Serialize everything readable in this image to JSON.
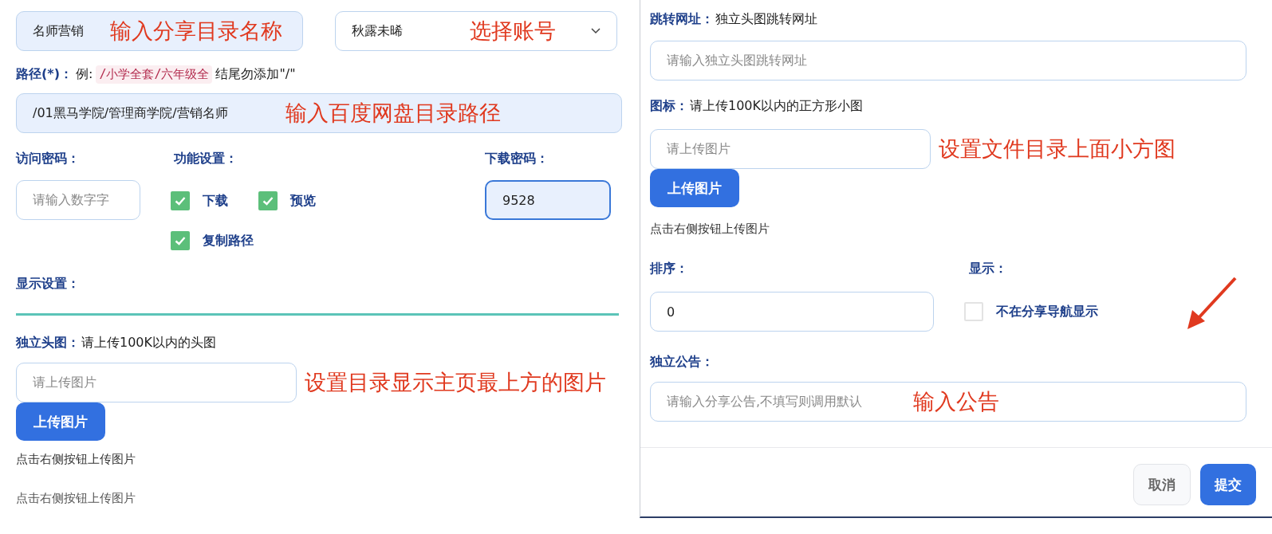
{
  "left_panel": {
    "name_field": {
      "value": "名师营销",
      "annotation": "输入分享目录名称"
    },
    "account_select": {
      "value": "秋露未晞",
      "annotation": "选择账号"
    },
    "path_hint": {
      "label": "路径(*)：",
      "prefix": "例:",
      "example": "/小学全套/六年级全",
      "suffix": "结尾勿添加\"/\""
    },
    "path_field": {
      "value": "/01黑马学院/管理商学院/营销名师",
      "annotation": "输入百度网盘目录路径"
    },
    "access_password": {
      "label": "访问密码：",
      "placeholder": "请输入数字字"
    },
    "features": {
      "label": "功能设置：",
      "options": [
        {
          "label": "下载",
          "checked": true
        },
        {
          "label": "预览",
          "checked": true
        },
        {
          "label": "复制路径",
          "checked": true
        }
      ]
    },
    "download_password": {
      "label": "下载密码：",
      "value": "9528"
    },
    "display_section": {
      "label": "显示设置："
    },
    "header_image": {
      "label": "独立头图：",
      "hint": "请上传100K以内的头图",
      "placeholder": "请上传图片",
      "annotation": "设置目录显示主页最上方的图片",
      "button": "上传图片",
      "note": "点击右侧按钮上传图片"
    },
    "ghost_note": "点击右侧按钮上传图片"
  },
  "right_panel": {
    "jump_url": {
      "label": "跳转网址：",
      "hint": "独立头图跳转网址",
      "placeholder": "请输入独立头图跳转网址"
    },
    "icon_image": {
      "label": "图标：",
      "hint": "请上传100K以内的正方形小图",
      "placeholder": "请上传图片",
      "annotation": "设置文件目录上面小方图",
      "button": "上传图片",
      "note": "点击右侧按钮上传图片"
    },
    "sort": {
      "label": "排序：",
      "value": "0"
    },
    "display": {
      "label": "显示：",
      "option": {
        "label": "不在分享导航显示",
        "checked": false
      }
    },
    "notice": {
      "label": "独立公告：",
      "placeholder": "请输入分享公告,不填写则调用默认",
      "annotation": "输入公告"
    },
    "footer": {
      "buttons": [
        {
          "label": "取消",
          "kind": "secondary"
        },
        {
          "label": "提交",
          "kind": "primary"
        }
      ]
    }
  }
}
